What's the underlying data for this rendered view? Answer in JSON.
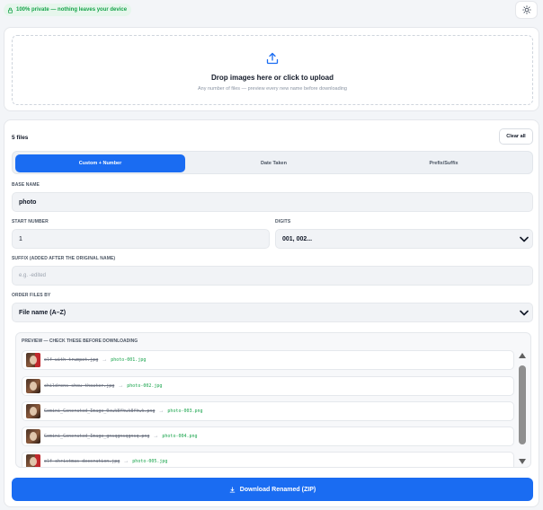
{
  "header": {
    "privacy_badge": "100% private — nothing leaves your device",
    "theme_toggle_icon": "sun-icon"
  },
  "upload": {
    "icon": "upload-icon",
    "title": "Drop images here or click to upload",
    "subtitle": "Any number of files — preview every new name before downloading"
  },
  "files": {
    "count_label": "5 files",
    "clear_label": "Clear all"
  },
  "tabs": [
    {
      "label": "Custom + Number",
      "active": true
    },
    {
      "label": "Date Taken",
      "active": false
    },
    {
      "label": "Prefix/Suffix",
      "active": false
    }
  ],
  "form": {
    "base_name": {
      "label": "BASE NAME",
      "value": "photo"
    },
    "start_number": {
      "label": "START NUMBER",
      "value": "1"
    },
    "digits": {
      "label": "DIGITS",
      "value": "001, 002..."
    },
    "suffix": {
      "label": "SUFFIX (ADDED AFTER THE ORIGINAL NAME)",
      "value": "",
      "placeholder": "e.g. -edited"
    },
    "order": {
      "label": "ORDER FILES BY",
      "value": "File name (A–Z)"
    }
  },
  "preview": {
    "title": "PREVIEW — CHECK THESE BEFORE DOWNLOADING",
    "arrow": "→",
    "items": [
      {
        "old": "elf-with-trumpet.jpg",
        "new": "photo-001.jpg"
      },
      {
        "old": "childrens-show-theater.jpg",
        "new": "photo-002.jpg"
      },
      {
        "old": "Gemini_Generated_Image_0xwk8fhwk8fhwk.png",
        "new": "photo-003.png"
      },
      {
        "old": "Gemini_Generated_Image_gnsqgnsqgnsq.png",
        "new": "photo-004.png"
      },
      {
        "old": "elf-christmas-decoration.jpg",
        "new": "photo-005.jpg"
      }
    ]
  },
  "download": {
    "label": "Download Renamed (ZIP)",
    "icon": "download-icon"
  },
  "colors": {
    "accent": "#1a6cf2",
    "success": "#16a34a"
  }
}
